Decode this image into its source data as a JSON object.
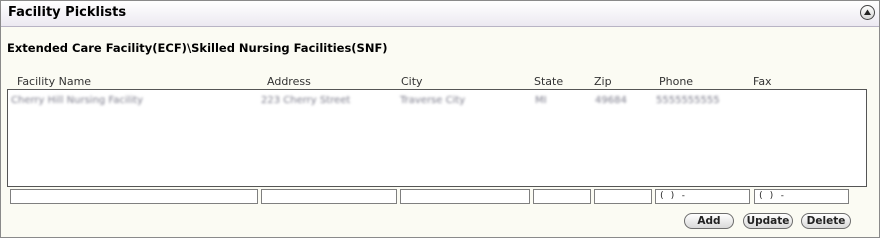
{
  "header": {
    "title": "Facility Picklists",
    "collapse_icon": "chevron-up-icon"
  },
  "section": {
    "title": "Extended Care Facility(ECF)\\Skilled Nursing Facilities(SNF)"
  },
  "columns": {
    "facility_name": "Facility Name",
    "address": "Address",
    "city": "City",
    "state": "State",
    "zip": "Zip",
    "phone": "Phone",
    "fax": "Fax"
  },
  "rows": [
    {
      "facility_name": "Cherry Hill Nursing Facility",
      "address": "223 Cherry Street",
      "city": "Traverse City",
      "state": "MI",
      "zip": "49684",
      "phone": "5555555555",
      "fax": ""
    }
  ],
  "inputs": {
    "facility_name": "",
    "address": "",
    "city": "",
    "state": "",
    "zip": "",
    "phone": "(  )   -",
    "fax": "(  )   -"
  },
  "buttons": {
    "add": "Add",
    "update": "Update",
    "delete": "Delete"
  }
}
